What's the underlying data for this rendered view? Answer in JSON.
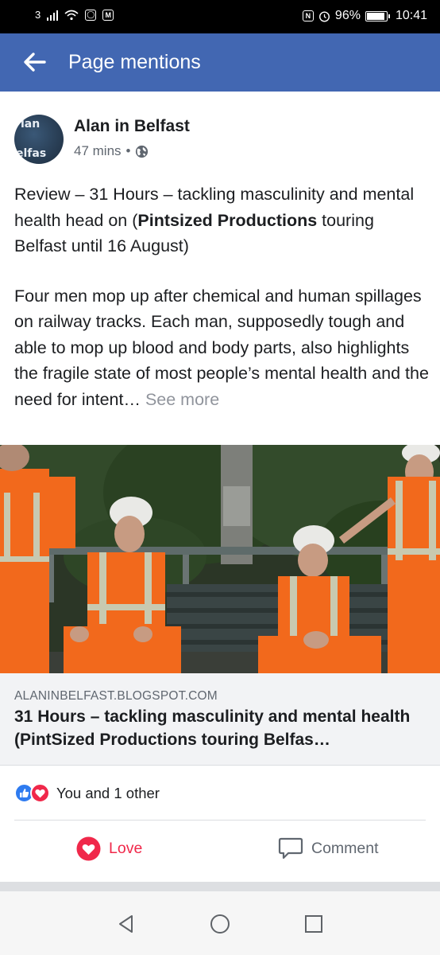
{
  "status_bar": {
    "carrier": "3",
    "battery": "96%",
    "battery_level": 0.96,
    "time": "10:41",
    "icons": [
      "signal-icon",
      "wifi-icon",
      "instagram-icon",
      "mail-icon",
      "nfc-icon",
      "alarm-icon",
      "battery-icon"
    ]
  },
  "header": {
    "title": "Page mentions",
    "back_icon": "back-arrow-icon"
  },
  "post": {
    "author": "Alan in Belfast",
    "avatar_lines": [
      "lan",
      "elfas"
    ],
    "time": "47 mins",
    "separator": "•",
    "privacy_icon": "globe-icon",
    "text_part1": "Review – 31 Hours – tackling masculinity and mental health head on (",
    "text_bold": "Pintsized Productions",
    "text_part2": " touring Belfast until 16 August)",
    "text_para2": "Four men mop up after chemical and human spillages on railway tracks. Each man, supposedly tough and able to mop up blood and body parts, also highlights the fragile state of most people’s mental health and the need for intent…",
    "see_more": "See more"
  },
  "link_preview": {
    "domain": "ALANINBELFAST.BLOGSPOT.COM",
    "title": "31 Hours – tackling masculinity and mental health (PintSized Productions touring Belfas…"
  },
  "reactions": {
    "icons": [
      "like-icon",
      "love-icon"
    ],
    "summary": "You and 1 other"
  },
  "actions": {
    "love_label": "Love",
    "comment_label": "Comment"
  },
  "colors": {
    "header_bg": "#4267b2",
    "love": "#f0284a",
    "like": "#2e7bf0",
    "hi_vis_orange": "#f2691c"
  },
  "nav": {
    "icons": [
      "back-triangle-icon",
      "home-circle-icon",
      "recents-square-icon"
    ]
  }
}
